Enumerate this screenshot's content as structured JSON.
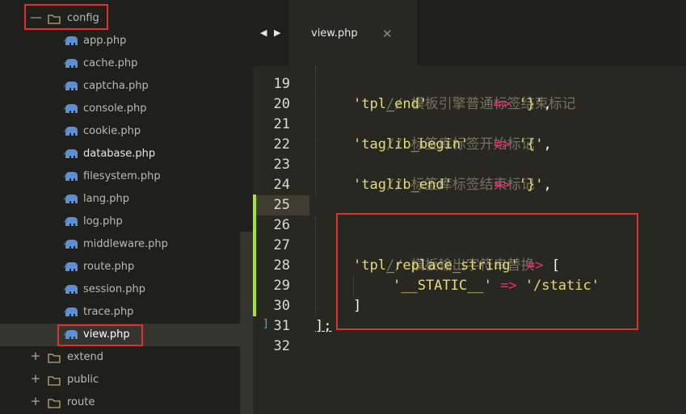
{
  "sidebar": {
    "root_folder": "config",
    "root_toggle": "—",
    "files": [
      {
        "name": "app.php"
      },
      {
        "name": "cache.php"
      },
      {
        "name": "captcha.php"
      },
      {
        "name": "console.php"
      },
      {
        "name": "cookie.php"
      },
      {
        "name": "database.php"
      },
      {
        "name": "filesystem.php"
      },
      {
        "name": "lang.php"
      },
      {
        "name": "log.php"
      },
      {
        "name": "middleware.php"
      },
      {
        "name": "route.php"
      },
      {
        "name": "session.php"
      },
      {
        "name": "trace.php"
      },
      {
        "name": "view.php"
      }
    ],
    "selected_file": "view.php",
    "folders": [
      {
        "name": "extend",
        "toggle": "+"
      },
      {
        "name": "public",
        "toggle": "+"
      },
      {
        "name": "route",
        "toggle": "+"
      }
    ]
  },
  "tabs": {
    "nav_left": "◀",
    "nav_right": "▶",
    "active_tab": "view.php",
    "close_glyph": "✕"
  },
  "editor": {
    "lines": [
      {
        "no": "19",
        "comment": "// 模板引擎普通标签结束标记"
      },
      {
        "no": "20",
        "key": "'tpl_end'",
        "pad": "       ",
        "arrow": "=>",
        "value": "'}'",
        "tail": ","
      },
      {
        "no": "21",
        "comment": "// 标签库标签开始标记"
      },
      {
        "no": "22",
        "key": "'taglib_begin'",
        "pad": "  ",
        "arrow": "=>",
        "value": "'{'",
        "tail": ","
      },
      {
        "no": "23",
        "comment": "// 标签库标签结束标记"
      },
      {
        "no": "24",
        "key": "'taglib_end'",
        "pad": "    ",
        "arrow": "=>",
        "value": "'}'",
        "tail": ","
      },
      {
        "no": "25"
      },
      {
        "no": "26"
      },
      {
        "no": "27",
        "comment": "// 模板输出字符串替换"
      },
      {
        "no": "28",
        "key": "'tpl_replace_string'",
        "pad": " ",
        "arrow": "=>",
        "value": "",
        "tail": "["
      },
      {
        "no": "29",
        "key": "'__STATIC__'",
        "pad": " ",
        "arrow": "=>",
        "value": "'/static'",
        "tail": ""
      },
      {
        "no": "30",
        "tail_only": "]"
      },
      {
        "no": "31",
        "tail_only": "];"
      },
      {
        "no": "32"
      }
    ],
    "fold_marker": "]"
  },
  "colors": {
    "background": "#272822",
    "sidebar": "#1f201b",
    "comment": "#75715e",
    "string": "#e6db74",
    "operator": "#f92672",
    "highlight_box": "#e2302f",
    "modified_gutter": "#a6e22e"
  }
}
